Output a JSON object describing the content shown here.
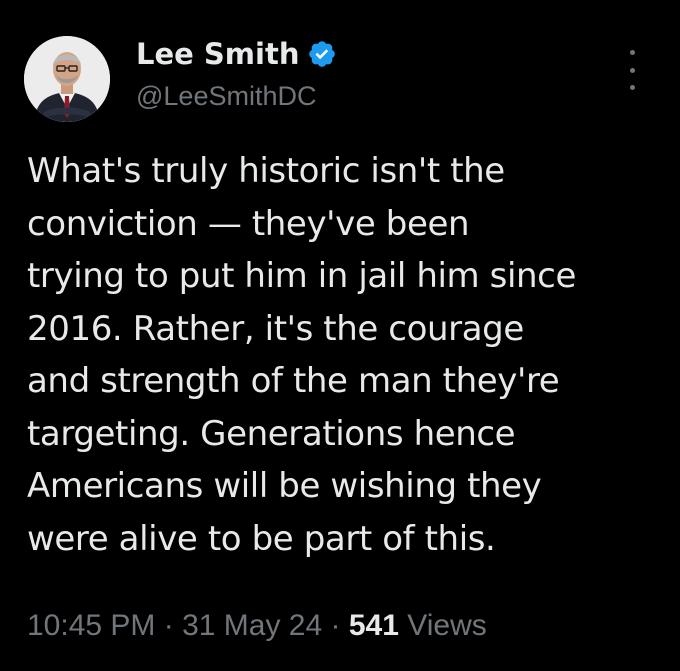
{
  "author": {
    "display_name": "Lee Smith",
    "handle": "@LeeSmithDC",
    "verified": true
  },
  "tweet": {
    "text": "What's truly historic isn't the\nconviction — they've been\ntrying to put him in jail him since\n2016. Rather, it's the courage\nand strength of the man they're\ntargeting. Generations hence\nAmericans will be wishing they\nwere alive to be part of this."
  },
  "meta": {
    "time": "10:45 PM",
    "separator": " · ",
    "date": "31 May 24",
    "views_count": "541",
    "views_label": "Views"
  },
  "icons": {
    "verified": "verified-badge-icon",
    "more": "more-options-icon"
  },
  "colors": {
    "background": "#000000",
    "primary_text": "#e7e9ea",
    "secondary_text": "#71767b",
    "verified_blue": "#1d9bf0"
  }
}
